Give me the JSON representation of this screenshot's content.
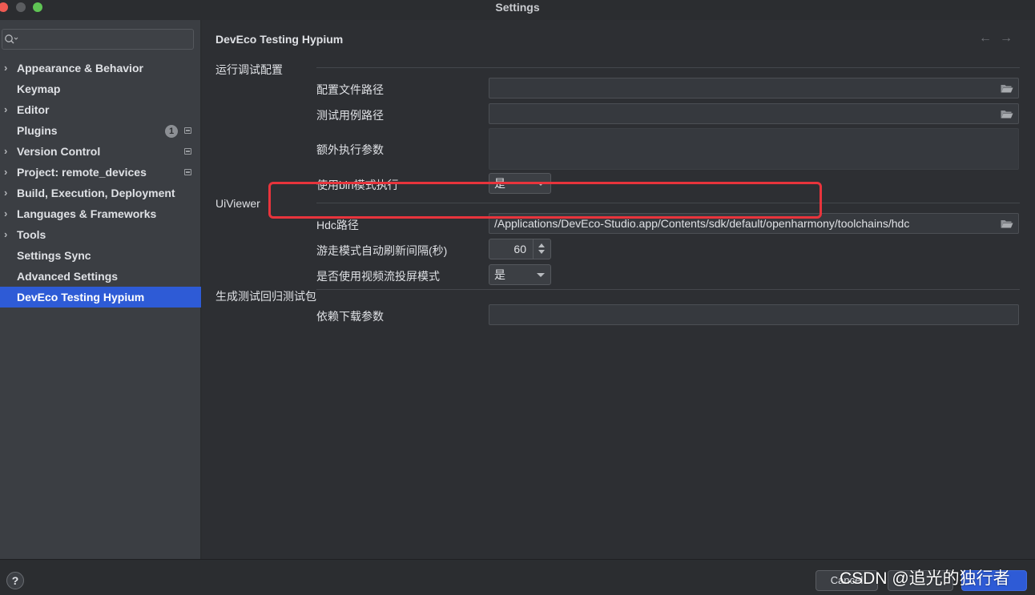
{
  "window": {
    "title": "Settings"
  },
  "search": {
    "placeholder": "",
    "icon": "search-icon"
  },
  "sidebar": {
    "items": [
      {
        "label": "Appearance & Behavior",
        "expandable": true
      },
      {
        "label": "Keymap",
        "expandable": false
      },
      {
        "label": "Editor",
        "expandable": true
      },
      {
        "label": "Plugins",
        "expandable": false,
        "badge": "1"
      },
      {
        "label": "Version Control",
        "expandable": true
      },
      {
        "label": "Project: remote_devices",
        "expandable": true
      },
      {
        "label": "Build, Execution, Deployment",
        "expandable": true
      },
      {
        "label": "Languages & Frameworks",
        "expandable": true
      },
      {
        "label": "Tools",
        "expandable": true
      },
      {
        "label": "Settings Sync",
        "expandable": false
      },
      {
        "label": "Advanced Settings",
        "expandable": false
      },
      {
        "label": "DevEco Testing Hypium",
        "expandable": false,
        "selected": true
      }
    ]
  },
  "page": {
    "title": "DevEco Testing Hypium",
    "back_arrow": "←",
    "forward_arrow": "→"
  },
  "sections": {
    "run_config": {
      "title": "运行调试配置",
      "config_path_label": "配置文件路径",
      "config_path_value": "",
      "testcase_path_label": "测试用例路径",
      "testcase_path_value": "",
      "extra_args_label": "额外执行参数",
      "extra_args_value": "",
      "bin_mode_label": "使用bin模式执行",
      "bin_mode_value": "是"
    },
    "uiviewer": {
      "title": "UiViewer",
      "hdc_path_label": "Hdc路径",
      "hdc_path_value": "/Applications/DevEco-Studio.app/Contents/sdk/default/openharmony/toolchains/hdc",
      "refresh_interval_label": "游走模式自动刷新间隔(秒)",
      "refresh_interval_value": "60",
      "video_stream_label": "是否使用视频流投屏模式",
      "video_stream_value": "是"
    },
    "regression": {
      "title": "生成测试回归测试包",
      "download_args_label": "依赖下载参数",
      "download_args_value": ""
    }
  },
  "footer": {
    "help": "?",
    "cancel_label": "Cancel",
    "watermark": "CSDN @追光的独行者"
  },
  "colors": {
    "accent": "#2e5bd6",
    "highlight": "#e8343c"
  }
}
